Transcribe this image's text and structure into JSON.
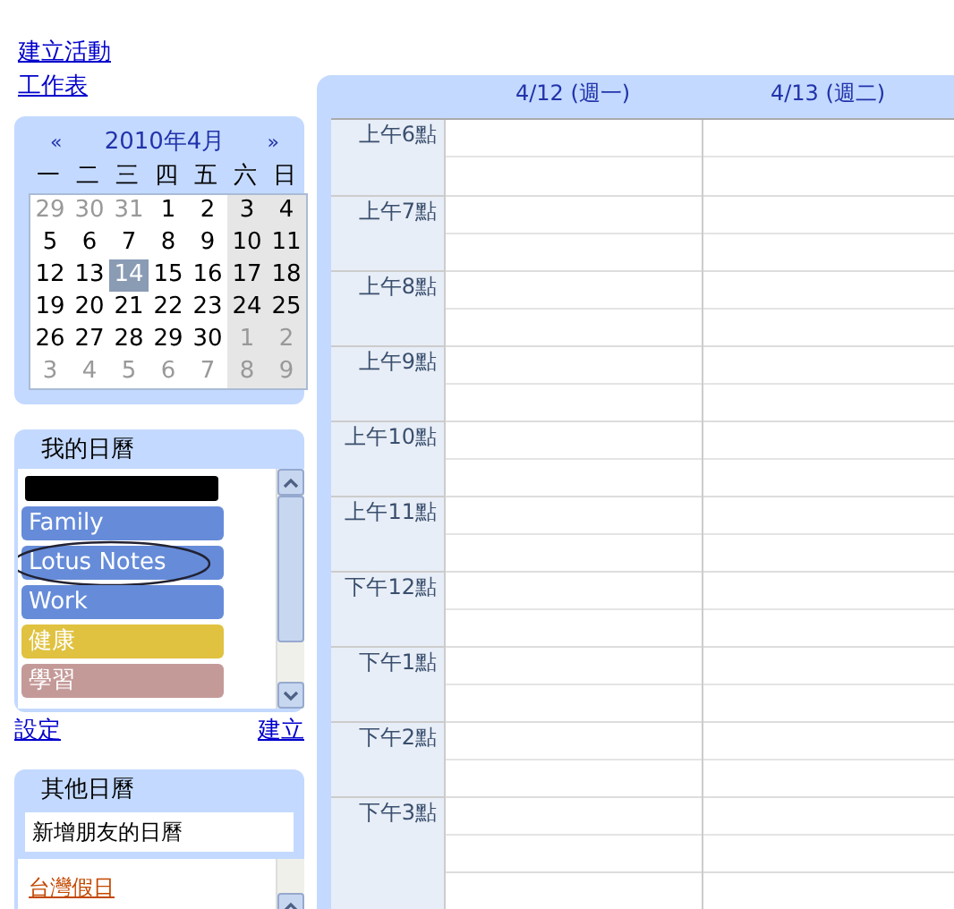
{
  "top_links": [
    "建立活動",
    "工作表"
  ],
  "mini_calendar": {
    "prev": "«",
    "title": "2010年4月",
    "next": "»",
    "weekdays": [
      "一",
      "二",
      "三",
      "四",
      "五",
      "六",
      "日"
    ],
    "weeks": [
      [
        {
          "day": "29",
          "muted": true,
          "selected": false
        },
        {
          "day": "30",
          "muted": true,
          "selected": false
        },
        {
          "day": "31",
          "muted": true,
          "selected": false
        },
        {
          "day": "1",
          "muted": false,
          "selected": false
        },
        {
          "day": "2",
          "muted": false,
          "selected": false
        },
        {
          "day": "3",
          "muted": false,
          "selected": false
        },
        {
          "day": "4",
          "muted": false,
          "selected": false
        }
      ],
      [
        {
          "day": "5",
          "muted": false,
          "selected": false
        },
        {
          "day": "6",
          "muted": false,
          "selected": false
        },
        {
          "day": "7",
          "muted": false,
          "selected": false
        },
        {
          "day": "8",
          "muted": false,
          "selected": false
        },
        {
          "day": "9",
          "muted": false,
          "selected": false
        },
        {
          "day": "10",
          "muted": false,
          "selected": false
        },
        {
          "day": "11",
          "muted": false,
          "selected": false
        }
      ],
      [
        {
          "day": "12",
          "muted": false,
          "selected": false
        },
        {
          "day": "13",
          "muted": false,
          "selected": false
        },
        {
          "day": "14",
          "muted": false,
          "selected": true
        },
        {
          "day": "15",
          "muted": false,
          "selected": false
        },
        {
          "day": "16",
          "muted": false,
          "selected": false
        },
        {
          "day": "17",
          "muted": false,
          "selected": false
        },
        {
          "day": "18",
          "muted": false,
          "selected": false
        }
      ],
      [
        {
          "day": "19",
          "muted": false,
          "selected": false
        },
        {
          "day": "20",
          "muted": false,
          "selected": false
        },
        {
          "day": "21",
          "muted": false,
          "selected": false
        },
        {
          "day": "22",
          "muted": false,
          "selected": false
        },
        {
          "day": "23",
          "muted": false,
          "selected": false
        },
        {
          "day": "24",
          "muted": false,
          "selected": false
        },
        {
          "day": "25",
          "muted": false,
          "selected": false
        }
      ],
      [
        {
          "day": "26",
          "muted": false,
          "selected": false
        },
        {
          "day": "27",
          "muted": false,
          "selected": false
        },
        {
          "day": "28",
          "muted": false,
          "selected": false
        },
        {
          "day": "29",
          "muted": false,
          "selected": false
        },
        {
          "day": "30",
          "muted": false,
          "selected": false
        },
        {
          "day": "1",
          "muted": true,
          "selected": false
        },
        {
          "day": "2",
          "muted": true,
          "selected": false
        }
      ],
      [
        {
          "day": "3",
          "muted": true,
          "selected": false
        },
        {
          "day": "4",
          "muted": true,
          "selected": false
        },
        {
          "day": "5",
          "muted": true,
          "selected": false
        },
        {
          "day": "6",
          "muted": true,
          "selected": false
        },
        {
          "day": "7",
          "muted": true,
          "selected": false
        },
        {
          "day": "8",
          "muted": true,
          "selected": false
        },
        {
          "day": "9",
          "muted": true,
          "selected": false
        }
      ]
    ]
  },
  "my_calendars": {
    "title": "我的日曆",
    "items": [
      {
        "kind": "redacted"
      },
      {
        "kind": "calendar",
        "name": "Family",
        "color": "#668cd9",
        "circled": false
      },
      {
        "kind": "calendar",
        "name": "Lotus Notes",
        "color": "#668cd9",
        "circled": true
      },
      {
        "kind": "calendar",
        "name": "Work",
        "color": "#668cd9",
        "circled": false
      },
      {
        "kind": "calendar",
        "name": "健康",
        "color": "#e0c240",
        "circled": false
      },
      {
        "kind": "calendar",
        "name": "學習",
        "color": "#c49a98",
        "circled": false
      }
    ],
    "settings_link": "設定",
    "create_link": "建立"
  },
  "other_calendars": {
    "title": "其他日曆",
    "add_field": "新增朋友的日曆",
    "items": [
      {
        "name": "台灣假日"
      }
    ]
  },
  "week_view": {
    "days": [
      "4/12 (週一)",
      "4/13 (週二)"
    ],
    "hours": [
      "上午6點",
      "上午7點",
      "上午8點",
      "上午9點",
      "上午10點",
      "上午11點",
      "下午12點",
      "下午1點",
      "下午2點",
      "下午3點"
    ]
  }
}
